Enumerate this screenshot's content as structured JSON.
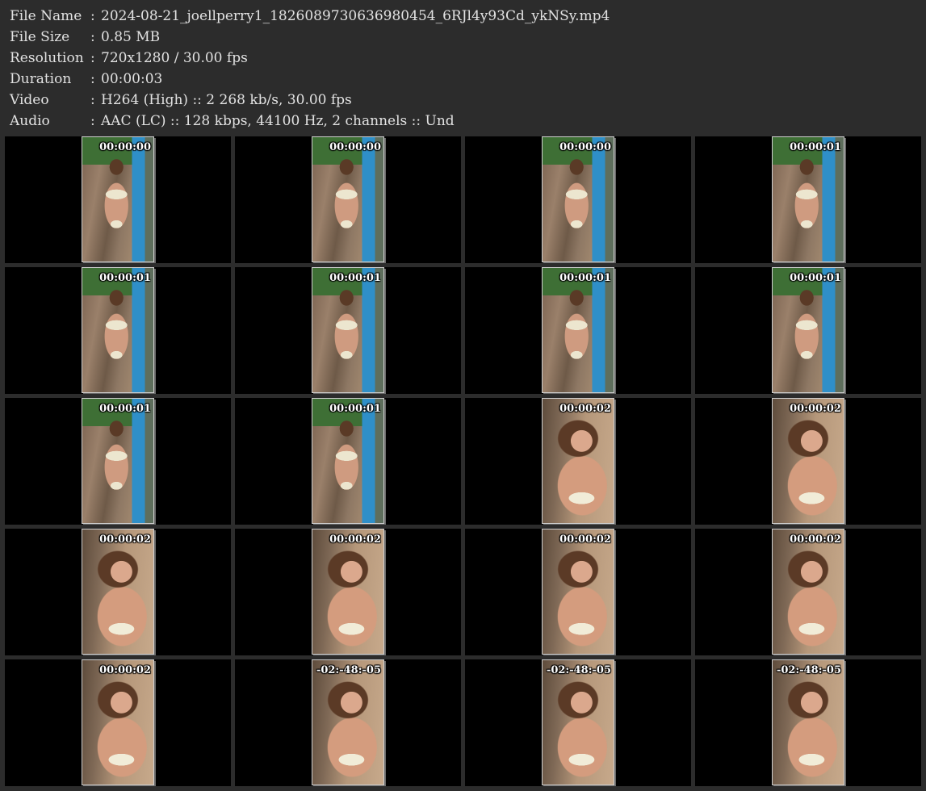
{
  "info": [
    {
      "label": "File Name",
      "sep": ":",
      "value": "2024-08-21_joellperry1_1826089730636980454_6RJl4y93Cd_ykNSy.mp4"
    },
    {
      "label": "File Size",
      "sep": ":",
      "value": "0.85 MB"
    },
    {
      "label": "Resolution",
      "sep": ":",
      "value": "720x1280 / 30.00 fps"
    },
    {
      "label": "Duration",
      "sep": ":",
      "value": "00:00:03"
    },
    {
      "label": "Video",
      "sep": ":",
      "value": "H264 (High) :: 2 268 kb/s, 30.00 fps"
    },
    {
      "label": "Audio",
      "sep": ":",
      "value": "AAC (LC) :: 128 kbps, 44100 Hz, 2 channels :: Und"
    }
  ],
  "thumbnails": [
    {
      "timestamp": "00:00:00",
      "scene": "pool"
    },
    {
      "timestamp": "00:00:00",
      "scene": "pool"
    },
    {
      "timestamp": "00:00:00",
      "scene": "pool"
    },
    {
      "timestamp": "00:00:01",
      "scene": "pool"
    },
    {
      "timestamp": "00:00:01",
      "scene": "pool"
    },
    {
      "timestamp": "00:00:01",
      "scene": "pool"
    },
    {
      "timestamp": "00:00:01",
      "scene": "pool"
    },
    {
      "timestamp": "00:00:01",
      "scene": "pool"
    },
    {
      "timestamp": "00:00:01",
      "scene": "pool"
    },
    {
      "timestamp": "00:00:01",
      "scene": "pool"
    },
    {
      "timestamp": "00:00:02",
      "scene": "close"
    },
    {
      "timestamp": "00:00:02",
      "scene": "close"
    },
    {
      "timestamp": "00:00:02",
      "scene": "close"
    },
    {
      "timestamp": "00:00:02",
      "scene": "close"
    },
    {
      "timestamp": "00:00:02",
      "scene": "close"
    },
    {
      "timestamp": "00:00:02",
      "scene": "close"
    },
    {
      "timestamp": "00:00:02",
      "scene": "close"
    },
    {
      "timestamp": "-02:-48:-05",
      "scene": "close"
    },
    {
      "timestamp": "-02:-48:-05",
      "scene": "close"
    },
    {
      "timestamp": "-02:-48:-05",
      "scene": "close"
    }
  ]
}
